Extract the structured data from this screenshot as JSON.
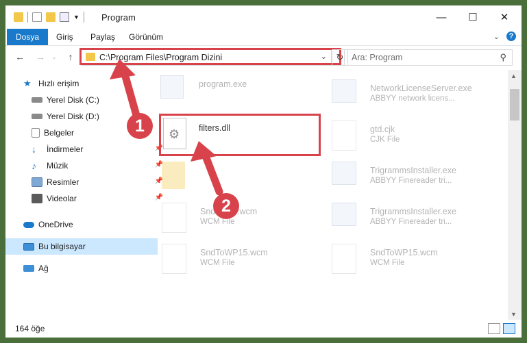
{
  "window": {
    "title": "Program",
    "controls": {
      "minimize": "—",
      "maximize": "☐",
      "close": "✕"
    }
  },
  "ribbon": {
    "tabs": [
      "Dosya",
      "Giriş",
      "Paylaş",
      "Görünüm"
    ],
    "help": "?"
  },
  "navigation": {
    "back": "←",
    "forward": "→",
    "up": "↑",
    "address": "C:\\Program Files\\Program Dizini",
    "search_placeholder": "Ara: Program"
  },
  "sidebar": {
    "items": [
      {
        "label": "Hızlı erişim",
        "icon": "star-icon"
      },
      {
        "label": "Yerel Disk (C:)",
        "icon": "drive-icon"
      },
      {
        "label": "Yerel Disk (D:)",
        "icon": "drive-icon"
      },
      {
        "label": "Belgeler",
        "icon": "documents-icon"
      },
      {
        "label": "İndirmeler",
        "icon": "download-icon"
      },
      {
        "label": "Müzik",
        "icon": "music-icon"
      },
      {
        "label": "Resimler",
        "icon": "pictures-icon"
      },
      {
        "label": "Videolar",
        "icon": "video-icon"
      },
      {
        "label": "OneDrive",
        "icon": "cloud-icon"
      },
      {
        "label": "Bu bilgisayar",
        "icon": "computer-icon"
      },
      {
        "label": "Ağ",
        "icon": "network-icon"
      }
    ]
  },
  "files": {
    "left": [
      {
        "name": "program.exe",
        "desc": ""
      },
      {
        "name": "filters.dll",
        "desc": ""
      },
      {
        "name": "",
        "desc": ""
      },
      {
        "name": "SndToWP.wcm",
        "desc": "WCM File"
      },
      {
        "name": "SndToWP15.wcm",
        "desc": "WCM File"
      }
    ],
    "right": [
      {
        "name": "NetworkLicenseServer.exe",
        "desc": "ABBYY network licens..."
      },
      {
        "name": "gtd.cjk",
        "desc": "CJK File"
      },
      {
        "name": "TrigrammsInstaller.exe",
        "desc": "ABBYY Finereader tri..."
      },
      {
        "name": "TrigrammsInstaller.exe",
        "desc": "ABBYY Finereader tri..."
      },
      {
        "name": "SndToWP15.wcm",
        "desc": "WCM File"
      }
    ]
  },
  "status": {
    "count": "164 öğe"
  },
  "annotations": {
    "step1": "1",
    "step2": "2"
  },
  "colors": {
    "accent": "#1979ca",
    "highlight": "#d8424a",
    "selected": "#cce8ff"
  }
}
